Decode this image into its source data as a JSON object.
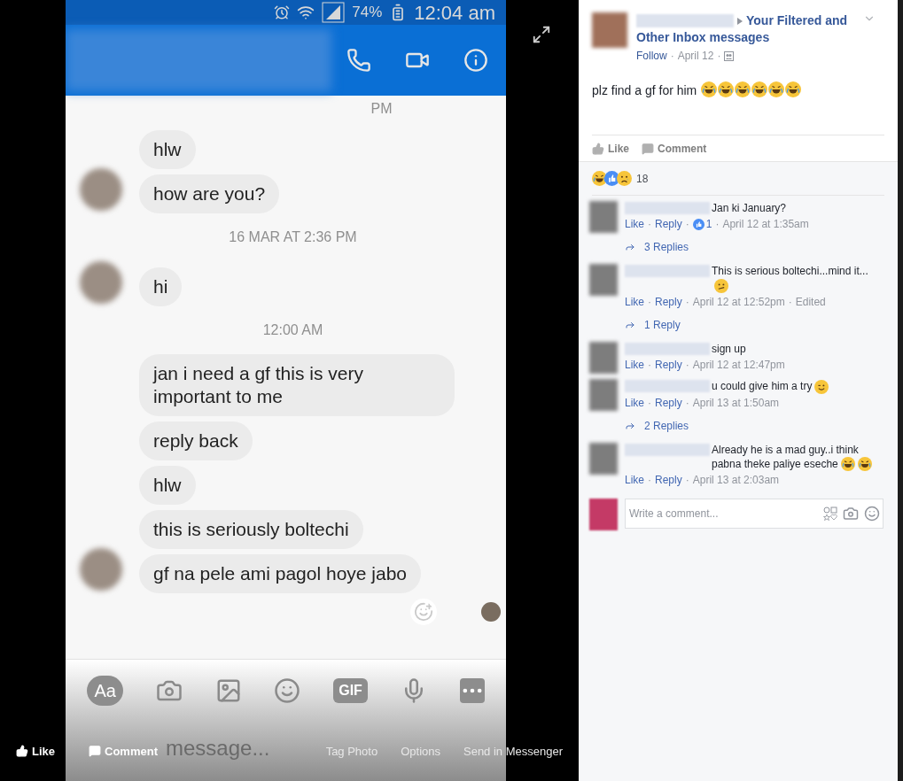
{
  "phone": {
    "status": {
      "battery": "74%",
      "time": "12:04 am"
    },
    "chat": [
      {
        "kind": "time",
        "text": "PM"
      },
      {
        "kind": "group",
        "bubbles": [
          "hlw",
          "how are you?"
        ]
      },
      {
        "kind": "time",
        "text": "16 MAR AT 2:36 PM"
      },
      {
        "kind": "group",
        "bubbles": [
          "hi"
        ]
      },
      {
        "kind": "time",
        "text": "12:00 AM"
      },
      {
        "kind": "group",
        "bubbles": [
          "jan i need a gf this is very important to me",
          "reply back",
          "hlw",
          "this is seriously boltechi",
          "gf na pele ami pagol hoye jabo"
        ]
      }
    ],
    "toolbar": [
      {
        "kind": "text",
        "text": "Aa"
      },
      {
        "kind": "camera"
      },
      {
        "kind": "image"
      },
      {
        "kind": "smile"
      },
      {
        "kind": "badge",
        "text": "GIF"
      },
      {
        "kind": "mic"
      },
      {
        "kind": "more"
      }
    ],
    "composer": {
      "placeholder": "message..."
    }
  },
  "photo_actions": [
    {
      "kind": "like",
      "text": "Like"
    },
    {
      "kind": "comment",
      "text": "Comment"
    },
    {
      "kind": "plain",
      "text": "Tag Photo"
    },
    {
      "kind": "plain",
      "text": "Options"
    },
    {
      "kind": "plain",
      "text": "Send in Messenger"
    }
  ],
  "post": {
    "group": "Your Filtered and Other Inbox messages",
    "follow": "Follow",
    "date": "April 12",
    "text": "plz find a gf for him",
    "emoji": [
      {
        "kind": "laugh"
      },
      {
        "kind": "laugh"
      },
      {
        "kind": "laugh"
      },
      {
        "kind": "laugh"
      },
      {
        "kind": "laugh"
      },
      {
        "kind": "laugh"
      }
    ],
    "actions": [
      {
        "kind": "like",
        "text": "Like"
      },
      {
        "kind": "comment",
        "text": "Comment"
      }
    ],
    "reactions": {
      "icons": [
        {
          "kind": "haha"
        },
        {
          "kind": "like"
        },
        {
          "kind": "sad"
        }
      ],
      "count": "18"
    }
  },
  "separator": "·",
  "comments": [
    {
      "text": "Jan ki January?",
      "meta": [
        {
          "kind": "link",
          "text": "Like"
        },
        {
          "kind": "link",
          "text": "Reply"
        },
        {
          "kind": "reaction",
          "text": "1"
        },
        {
          "kind": "time",
          "text": "April 12 at 1:35am"
        }
      ],
      "replies": "3 Replies"
    },
    {
      "text": "This is serious boltechi...mind it...",
      "emoji": [
        {
          "kind": "confused"
        }
      ],
      "meta": [
        {
          "kind": "link",
          "text": "Like"
        },
        {
          "kind": "link",
          "text": "Reply"
        },
        {
          "kind": "time",
          "text": "April 12 at 12:52pm"
        },
        {
          "kind": "time",
          "text": "Edited"
        }
      ],
      "replies": "1 Reply"
    },
    {
      "text": "sign up",
      "meta": [
        {
          "kind": "link",
          "text": "Like"
        },
        {
          "kind": "link",
          "text": "Reply"
        },
        {
          "kind": "time",
          "text": "April 12 at 12:47pm"
        }
      ]
    },
    {
      "text": "u could give him a try",
      "emoji": [
        {
          "kind": "wink"
        }
      ],
      "meta": [
        {
          "kind": "link",
          "text": "Like"
        },
        {
          "kind": "link",
          "text": "Reply"
        },
        {
          "kind": "time",
          "text": "April 13 at 1:50am"
        }
      ],
      "replies": "2 Replies"
    },
    {
      "text": "Already he is a mad guy..i think pabna theke paliye eseche",
      "emoji": [
        {
          "kind": "laugh"
        },
        {
          "kind": "laugh"
        }
      ],
      "meta": [
        {
          "kind": "link",
          "text": "Like"
        },
        {
          "kind": "link",
          "text": "Reply"
        },
        {
          "kind": "time",
          "text": "April 13 at 2:03am"
        }
      ]
    }
  ],
  "comment_box": {
    "placeholder": "Write a comment..."
  }
}
